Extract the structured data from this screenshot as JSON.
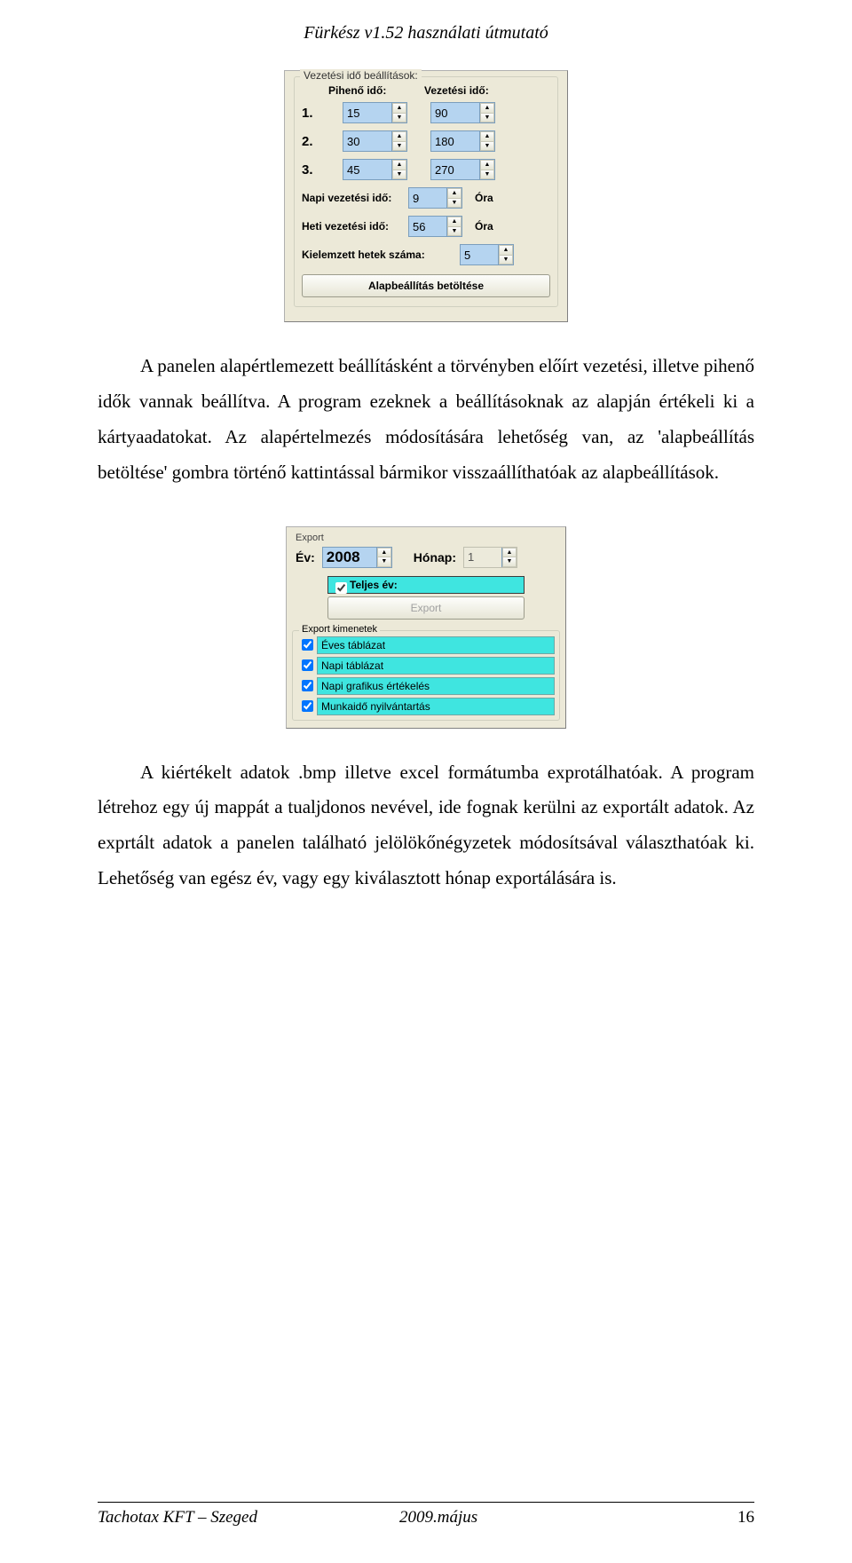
{
  "header": {
    "title": "Fürkész v1.52 használati útmutató"
  },
  "panel1": {
    "group_title": "Vezetési idő beállítások:",
    "col_rest": "Pihenő idő:",
    "col_drive": "Vezetési idő:",
    "rows": [
      {
        "n": "1.",
        "rest": "15",
        "drive": "90"
      },
      {
        "n": "2.",
        "rest": "30",
        "drive": "180"
      },
      {
        "n": "3.",
        "rest": "45",
        "drive": "270"
      }
    ],
    "daily_label": "Napi vezetési idő:",
    "daily_value": "9",
    "weekly_label": "Heti vezetési idő:",
    "weekly_value": "56",
    "unit": "Óra",
    "weeks_label": "Kielemzett hetek száma:",
    "weeks_value": "5",
    "load_btn": "Alapbeállítás betöltése"
  },
  "para1": "A panelen alapértlemezett beállításként a törvényben előírt vezetési, illetve pihenő idők vannak beállítva. A program ezeknek a beállításoknak az alapján értékeli ki a kártyaadatokat. Az alapértelmezés módosítására lehetőség van, az 'alapbeállítás betöltése' gombra történő kattintással bármikor  visszaállíthatóak az alapbeállítások.",
  "panel2": {
    "top_label": "Export",
    "year_label": "Év:",
    "year_value": "2008",
    "month_label": "Hónap:",
    "month_value": "1",
    "full_year_label": "Teljes év:",
    "export_btn": "Export",
    "group_title": "Export kimenetek",
    "outputs": [
      "Éves táblázat",
      "Napi táblázat",
      "Napi grafikus értékelés",
      "Munkaidő nyilvántartás"
    ]
  },
  "para2": "A kiértékelt adatok .bmp illetve excel formátumba exprotálhatóak. A program létrehoz egy új mappát  a tualjdonos nevével, ide fognak kerülni az exportált adatok. Az exprtált adatok a panelen található jelölökőnégyzetek módosítsával választhatóak ki. Lehetőség van egész év, vagy egy kiválasztott hónap exportálására is.",
  "footer": {
    "left": "Tachotax KFT – Szeged",
    "center": "2009.május",
    "page": "16"
  }
}
